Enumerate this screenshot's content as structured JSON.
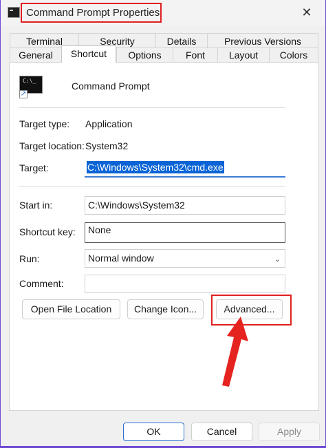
{
  "window": {
    "title": "Command Prompt Properties",
    "close_glyph": "✕",
    "accent_color": "#6d4ad1"
  },
  "tabs": {
    "row1": [
      "Terminal",
      "Security",
      "Details",
      "Previous Versions"
    ],
    "row2": [
      "General",
      "Shortcut",
      "Options",
      "Font",
      "Layout",
      "Colors"
    ],
    "active": "Shortcut"
  },
  "app": {
    "icon": "cmd-terminal-icon",
    "icon_text": "C:\\_",
    "name": "Command Prompt"
  },
  "info": {
    "target_type_label": "Target type:",
    "target_type_value": "Application",
    "target_location_label": "Target location:",
    "target_location_value": "System32",
    "target_label": "Target:",
    "target_value": "C:\\Windows\\System32\\cmd.exe"
  },
  "fields": {
    "start_in_label": "Start in:",
    "start_in_value": "C:\\Windows\\System32",
    "shortcut_key_label": "Shortcut key:",
    "shortcut_key_value": "None",
    "run_label": "Run:",
    "run_value": "Normal window",
    "comment_label": "Comment:",
    "comment_value": ""
  },
  "buttons": {
    "open_file_location": "Open File Location",
    "change_icon": "Change Icon...",
    "advanced": "Advanced..."
  },
  "dialog": {
    "ok": "OK",
    "cancel": "Cancel",
    "apply": "Apply"
  },
  "annotations": {
    "highlight_color": "#e02020"
  }
}
